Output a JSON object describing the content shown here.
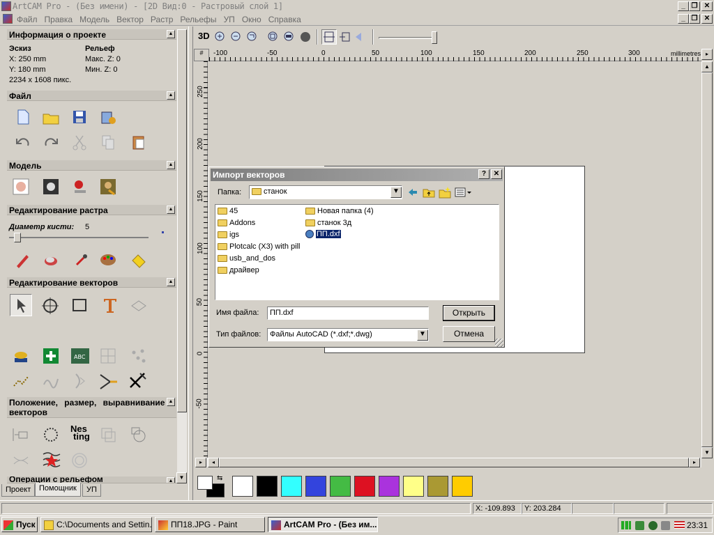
{
  "window": {
    "title": "ArtCAM Pro - (Без имени) - [2D Вид:0 - Растровый слой 1]"
  },
  "menu": {
    "items": [
      "Файл",
      "Правка",
      "Модель",
      "Вектор",
      "Растр",
      "Рельефы",
      "УП",
      "Окно",
      "Справка"
    ]
  },
  "project_info": {
    "title": "Информация о проекте",
    "sketch_label": "Эскиз",
    "relief_label": "Рельеф",
    "x": "X: 250 mm",
    "y": "Y: 180 mm",
    "pixels": "2234 x 1608 пикс.",
    "max_z": "Макс. Z: 0",
    "min_z": "Мин. Z: 0"
  },
  "sections": {
    "file": "Файл",
    "model": "Модель",
    "raster_edit": "Редактирование растра",
    "brush_label": "Диаметр кисти:",
    "brush_value": "5",
    "vector_edit": "Редактирование векторов",
    "position": "Положение, размер, выравнивание векторов",
    "relief_ops": "Операции с рельефом"
  },
  "nesting_label": {
    "line1": "Nes",
    "line2": "ting"
  },
  "tabs": [
    "Проект",
    "Помощник",
    "УП"
  ],
  "view_toolbar": {
    "label_3d": "3D"
  },
  "ruler": {
    "unit": "millimetres",
    "top_ticks": [
      "-100",
      "-50",
      "0",
      "50",
      "100",
      "150",
      "200",
      "250",
      "300"
    ],
    "left_ticks": [
      "250",
      "200",
      "150",
      "100",
      "50",
      "0",
      "-50"
    ]
  },
  "dialog": {
    "title": "Импорт векторов",
    "help_btn": "?",
    "close_btn": "✕",
    "folder_label": "Папка:",
    "folder_value": "станок",
    "files_col1": [
      "45",
      "Addons",
      "igs",
      "Plotcalc (X3) with pill",
      "usb_and_dos",
      "драйвер"
    ],
    "files_col2": [
      "Новая папка (4)",
      "станок 3д",
      "ПП.dxf"
    ],
    "filename_label": "Имя файла:",
    "filename_value": "ПП.dxf",
    "filetype_label": "Тип файлов:",
    "filetype_value": "Файлы AutoCAD (*.dxf;*.dwg)",
    "open_btn": "Открыть",
    "cancel_btn": "Отмена"
  },
  "palette": {
    "colors": [
      "#ffffff",
      "#000000",
      "#33ffff",
      "#3344dd",
      "#44bb44",
      "#dd1122",
      "#aa33dd",
      "#ffff88",
      "#aa9933",
      "#ffcc00"
    ]
  },
  "status": {
    "x": "X: -109.893",
    "y": "Y: 203.284"
  },
  "taskbar": {
    "start": "Пуск",
    "tasks": [
      "C:\\Documents and Settin...",
      "ПП18.JPG - Paint",
      "ArtCAM Pro - (Без им..."
    ],
    "clock": "23:31"
  }
}
